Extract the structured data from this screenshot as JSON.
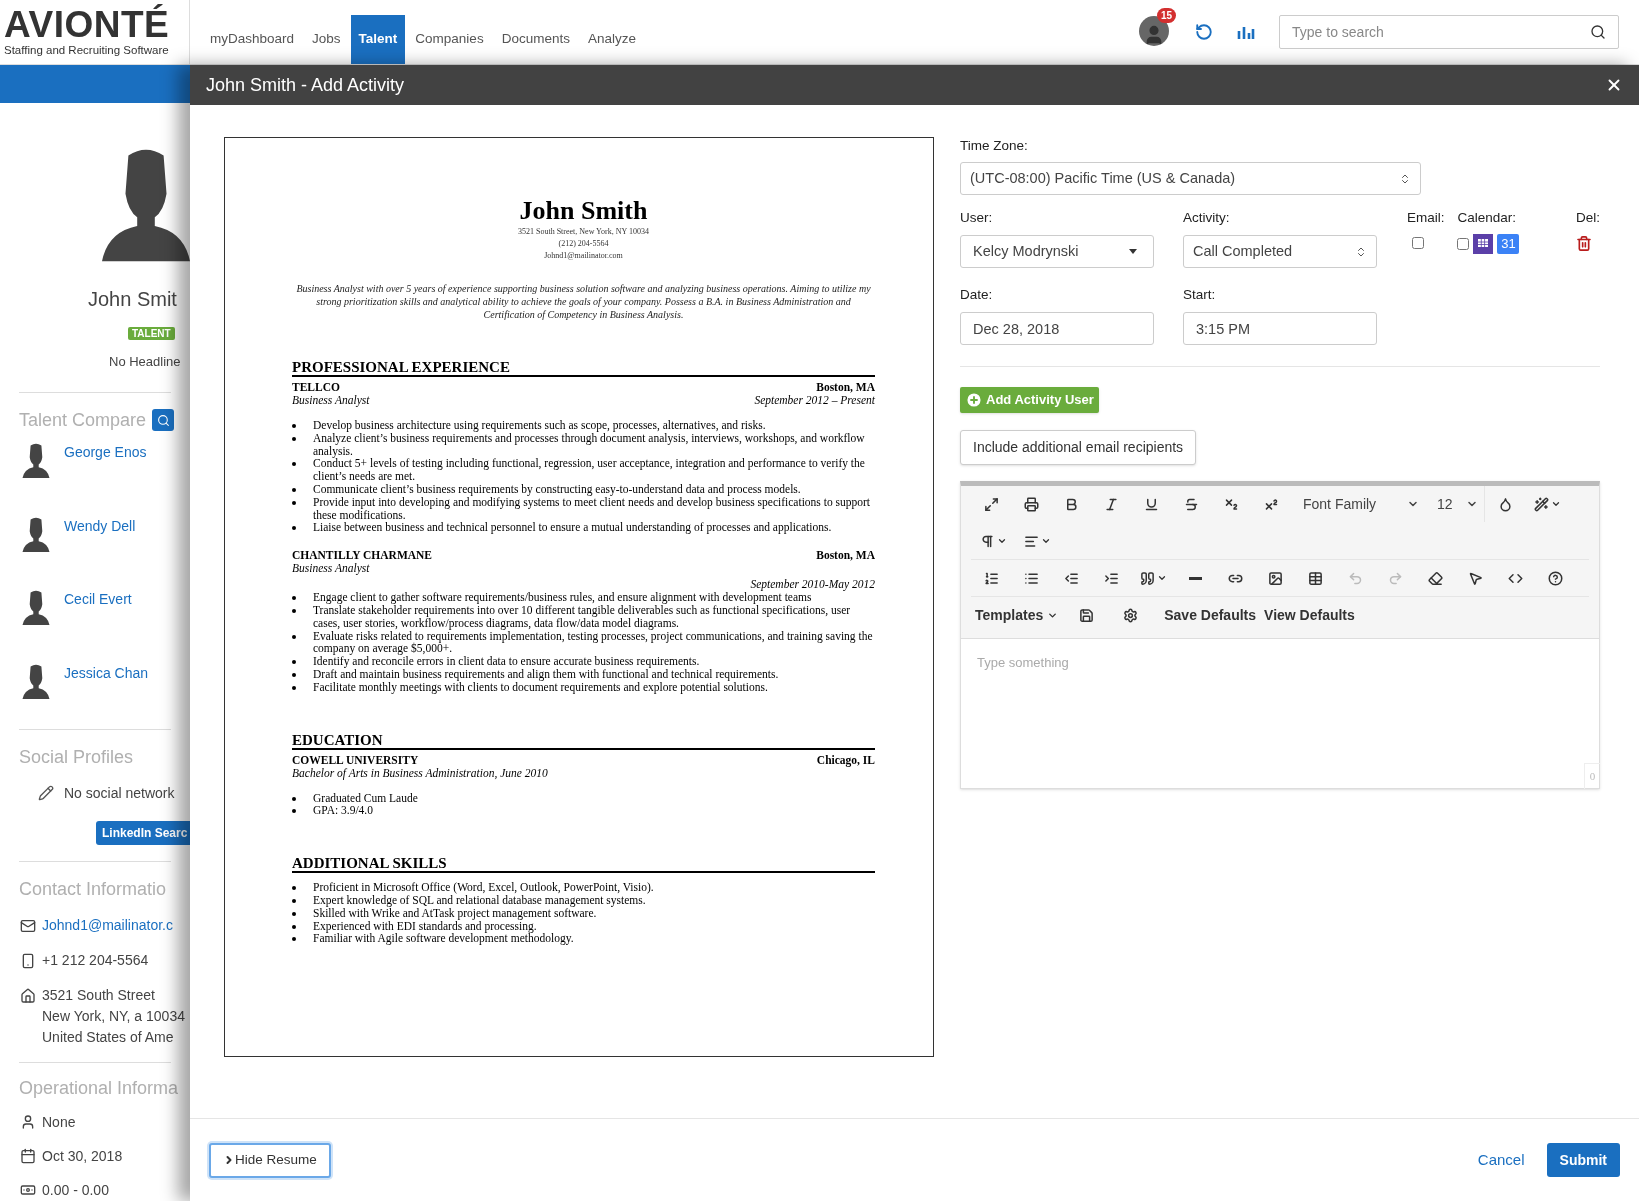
{
  "brand": {
    "name": "AVIONTÉ",
    "tagline": "Staffing and Recruiting Software"
  },
  "nav": [
    {
      "label": "myDashboard",
      "selected": false
    },
    {
      "label": "Jobs",
      "selected": false
    },
    {
      "label": "Talent",
      "selected": true
    },
    {
      "label": "Companies",
      "selected": false
    },
    {
      "label": "Documents",
      "selected": false
    },
    {
      "label": "Analyze",
      "selected": false
    }
  ],
  "notifications": {
    "count": "15"
  },
  "search": {
    "placeholder": "Type to search"
  },
  "sidebar": {
    "name": "John Smit",
    "badge": "TALENT",
    "headline": "No Headline",
    "talent_compare": {
      "title": "Talent Compare",
      "people": [
        "George Enos",
        "Wendy Dell",
        "Cecil Evert",
        "Jessica Chan"
      ]
    },
    "social": {
      "title": "Social Profiles",
      "empty": "No social network",
      "button": "LinkedIn Searc"
    },
    "contact": {
      "title": "Contact Informatio",
      "items": [
        {
          "kind": "email",
          "lines": [
            "Johnd1@mailinator.c"
          ]
        },
        {
          "kind": "phone",
          "lines": [
            "+1 212 204-5564"
          ]
        },
        {
          "kind": "address",
          "lines": [
            "3521 South Street",
            "New York, NY, a 10034",
            "United States of Ame"
          ]
        }
      ]
    },
    "operational": {
      "title": "Operational Informa",
      "items": [
        {
          "kind": "user",
          "text": "None"
        },
        {
          "kind": "date",
          "text": "Oct 30, 2018"
        },
        {
          "kind": "money",
          "text": "0.00 - 0.00"
        }
      ]
    }
  },
  "modal": {
    "title": "John Smith - Add Activity",
    "resume": {
      "name": "John Smith",
      "contact": [
        "3521 South Street, New York, NY 10034",
        "(212) 204-5564",
        "Johnd1@mailinator.com"
      ],
      "summary": "Business Analyst with over 5 years of experience supporting business solution software and analyzing business operations. Aiming to utilize my strong prioritization skills and analytical ability to achieve the goals of your company. Possess a B.A. in Business Administration and Certification of Competency in Business Analysis.",
      "sections": [
        {
          "title": "PROFESSIONAL EXPERIENCE",
          "entries": [
            {
              "org": "TELLCO",
              "location": "Boston, MA",
              "role": "Business Analyst",
              "dates": "September 2012 – Present",
              "kind": "inline",
              "bullets": [
                "Develop business architecture using requirements such as scope, processes, alternatives, and risks.",
                "Analyze client’s business requirements and processes through document analysis, interviews, workshops, and workflow analysis.",
                "Conduct 5+ levels of testing including functional, regression, user acceptance, integration and performance to verify the client’s needs are met.",
                "Communicate client’s business requirements by constructing easy-to-understand data and process models.",
                "Provide input into developing and modifying systems to meet client needs and develop business specifications to support these modifications.",
                "Liaise between business and technical personnel to ensure a mutual understanding of processes and applications."
              ]
            },
            {
              "org": "CHANTILLY CHARMANE",
              "location": "Boston, MA",
              "role": "Business Analyst",
              "dates": "September 2010-May 2012",
              "kind": "stacked",
              "bullets": [
                "Engage client to gather software requirements/business rules, and ensure alignment with development teams",
                "Translate stakeholder requirements into over 10 different tangible deliverables such as functional specifications, user cases, user stories, workflow/process diagrams, data flow/data model diagrams.",
                "Evaluate risks related to requirements implementation, testing processes, project communications, and training saving the company on average $5,000+.",
                "Identify and reconcile errors in client data to ensure accurate business requirements.",
                "Draft and maintain business requirements and align them with functional and technical requirements.",
                "Facilitate monthly meetings with clients to document requirements and explore potential solutions."
              ]
            }
          ]
        },
        {
          "title": "EDUCATION",
          "entries": [
            {
              "org": "COWELL UNIVERSITY",
              "location": "Chicago, IL",
              "role": "Bachelor of Arts in Business Administration, June 2010",
              "kind": "inline",
              "bullets": [
                "Graduated Cum Laude",
                "GPA: 3.9/4.0"
              ]
            }
          ]
        },
        {
          "title": "ADDITIONAL SKILLS",
          "bullets": [
            "Proficient in Microsoft Office (Word, Excel, Outlook, PowerPoint, Visio).",
            "Expert knowledge of SQL and relational database management systems.",
            "Skilled with Wrike and AtTask project management software.",
            "Experienced with EDI standards and processing.",
            "Familiar with Agile software development methodology."
          ]
        }
      ]
    },
    "form": {
      "time_zone": {
        "label": "Time Zone:",
        "value": "(UTC-08:00) Pacific Time (US & Canada)"
      },
      "user": {
        "label": "User:",
        "value": "Kelcy Modrynski"
      },
      "activity": {
        "label": "Activity:",
        "value": "Call Completed"
      },
      "email": {
        "label": "Email:",
        "checked": false
      },
      "calendar": {
        "label": "Calendar:",
        "checked": false,
        "date_badge": "31"
      },
      "delete": {
        "label": "Del:"
      },
      "date": {
        "label": "Date:",
        "value": "Dec 28, 2018"
      },
      "start": {
        "label": "Start:",
        "value": "3:15 PM"
      },
      "add_user_button": "Add Activity User",
      "recipients_button": "Include additional email recipients",
      "editor": {
        "font_family": "Font Family",
        "font_size": "12",
        "undo_disabled": true,
        "redo_disabled": true,
        "templates": "Templates",
        "save_defaults": "Save Defaults",
        "view_defaults": "View Defaults",
        "placeholder": "Type something",
        "char_count": "0"
      }
    },
    "footer": {
      "hide_resume": "Hide Resume",
      "cancel": "Cancel",
      "submit": "Submit"
    }
  }
}
